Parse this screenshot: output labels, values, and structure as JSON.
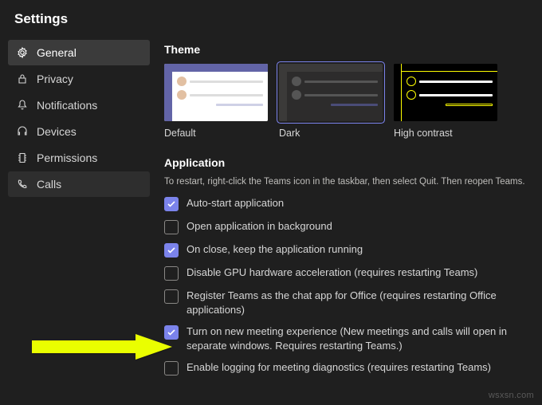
{
  "header": {
    "title": "Settings"
  },
  "sidebar": {
    "items": [
      {
        "label": "General"
      },
      {
        "label": "Privacy"
      },
      {
        "label": "Notifications"
      },
      {
        "label": "Devices"
      },
      {
        "label": "Permissions"
      },
      {
        "label": "Calls"
      }
    ]
  },
  "theme": {
    "section_title": "Theme",
    "options": [
      {
        "label": "Default"
      },
      {
        "label": "Dark"
      },
      {
        "label": "High contrast"
      }
    ]
  },
  "application": {
    "section_title": "Application",
    "note": "To restart, right-click the Teams icon in the taskbar, then select Quit. Then reopen Teams.",
    "options": [
      {
        "label": "Auto-start application",
        "checked": true
      },
      {
        "label": "Open application in background",
        "checked": false
      },
      {
        "label": "On close, keep the application running",
        "checked": true
      },
      {
        "label": "Disable GPU hardware acceleration (requires restarting Teams)",
        "checked": false
      },
      {
        "label": "Register Teams as the chat app for Office (requires restarting Office applications)",
        "checked": false
      },
      {
        "label": "Turn on new meeting experience (New meetings and calls will open in separate windows. Requires restarting Teams.)",
        "checked": true
      },
      {
        "label": "Enable logging for meeting diagnostics (requires restarting Teams)",
        "checked": false
      }
    ]
  },
  "watermark": "wsxsn.com"
}
